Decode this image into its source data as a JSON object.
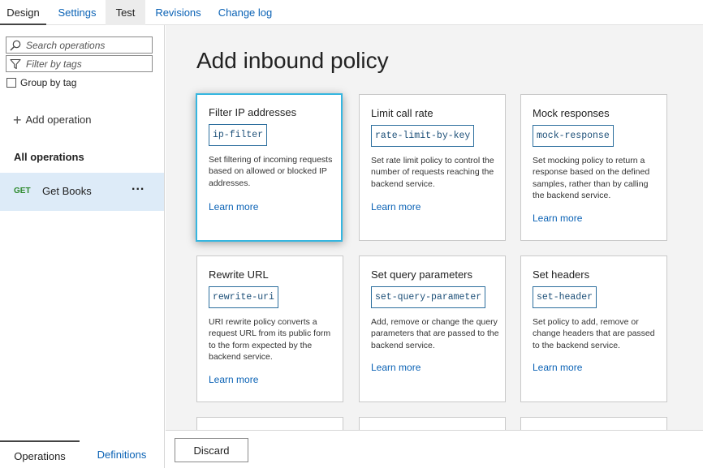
{
  "tabs": [
    {
      "label": "Design"
    },
    {
      "label": "Settings"
    },
    {
      "label": "Test"
    },
    {
      "label": "Revisions"
    },
    {
      "label": "Change log"
    }
  ],
  "left_panel": {
    "search_placeholder": "Search operations",
    "filter_placeholder": "Filter by tags",
    "group_by_tag_label": "Group by tag",
    "group_by_tag_checked": false,
    "add_operation_label": "Add operation",
    "all_operations_label": "All operations",
    "operations": [
      {
        "method": "GET",
        "name": "Get Books",
        "more": "..."
      }
    ],
    "bottom_tabs": [
      {
        "label": "Operations"
      },
      {
        "label": "Definitions"
      }
    ]
  },
  "main": {
    "title": "Add inbound policy",
    "policies": [
      {
        "title": "Filter IP addresses",
        "code": "ip-filter",
        "description": "Set filtering of incoming requests based on allowed or blocked IP addresses.",
        "link": "Learn more"
      },
      {
        "title": "Limit call rate",
        "code": "rate-limit-by-key",
        "description": "Set rate limit policy to control the number of requests reaching the backend service.",
        "link": "Learn more"
      },
      {
        "title": "Mock responses",
        "code": "mock-response",
        "description": "Set mocking policy to return a response based on the defined samples, rather than by calling the backend service.",
        "link": "Learn more"
      },
      {
        "title": "Rewrite URL",
        "code": "rewrite-uri",
        "description": "URI rewrite policy converts a request URL from its public form to the form expected by the backend service.",
        "link": "Learn more"
      },
      {
        "title": "Set query parameters",
        "code": "set-query-parameter",
        "description": "Add, remove or change the query parameters that are passed to the backend service.",
        "link": "Learn more"
      },
      {
        "title": "Set headers",
        "code": "set-header",
        "description": "Set policy to add, remove or change headers that are passed to the backend service.",
        "link": "Learn more"
      }
    ]
  },
  "footer": {
    "discard_label": "Discard"
  },
  "colors": {
    "link": "#0a62b5",
    "selected_border": "#35b6e0",
    "selected_row": "#ddebf8",
    "get_method": "#2e8a2e"
  },
  "icons": [
    "search-icon",
    "filter-icon",
    "plus-icon",
    "more-icon"
  ]
}
